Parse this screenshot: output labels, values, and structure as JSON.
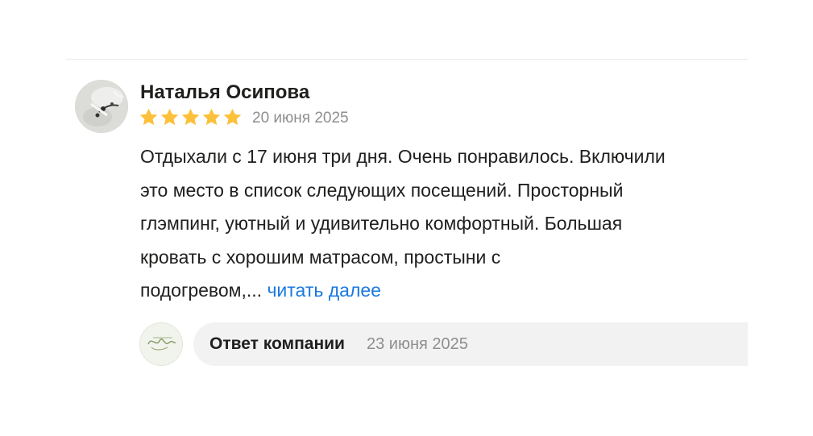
{
  "review": {
    "author": "Наталья Осипова",
    "rating": 5,
    "rating_max": 5,
    "date": "20 июня 2025",
    "text_lines": [
      "Отдыхали с 17 июня три дня. Очень понравилось. Включили",
      "это место в список следующих посещений. Просторный",
      "глэмпинг, уютный и удивительно комфортный. Большая",
      "кровать с хорошим матрасом, простыни с",
      "подогревом,..."
    ],
    "read_more": "читать далее"
  },
  "company_reply": {
    "label": "Ответ компании",
    "date": "23 июня 2025"
  },
  "icons": {
    "star": "star-icon",
    "user_avatar": "user-avatar",
    "company_avatar": "company-logo"
  },
  "colors": {
    "star": "#fcc03a",
    "link": "#1a79e0",
    "muted_text": "#8e8e8e",
    "reply_background": "#f2f2f2"
  }
}
